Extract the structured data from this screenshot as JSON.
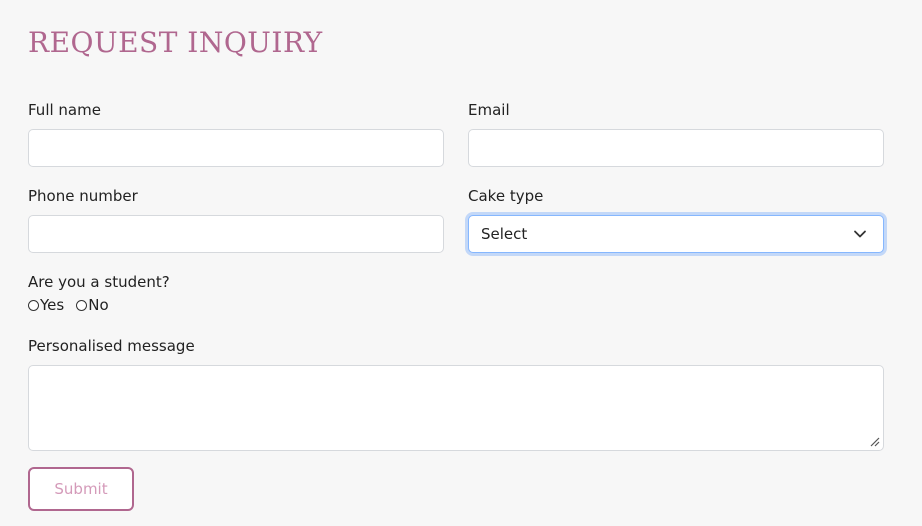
{
  "form": {
    "title": "REQUEST INQUIRY",
    "fields": {
      "full_name": {
        "label": "Full name",
        "value": ""
      },
      "email": {
        "label": "Email",
        "value": ""
      },
      "phone": {
        "label": "Phone number",
        "value": ""
      },
      "cake_type": {
        "label": "Cake type",
        "selected": "Select"
      }
    },
    "student_question": {
      "label": "Are you a student?",
      "options": [
        "Yes",
        "No"
      ]
    },
    "message": {
      "label": "Personalised message",
      "value": ""
    },
    "submit_label": "Submit"
  },
  "colors": {
    "accent": "#b0678f",
    "submit_text": "#d49ab9",
    "focus_border": "#86b7fe",
    "input_border": "#d6d9dd",
    "background": "#f7f7f7"
  },
  "icons": {
    "select_arrow": "chevron-down-icon",
    "textarea_resize": "resize-handle-icon"
  }
}
